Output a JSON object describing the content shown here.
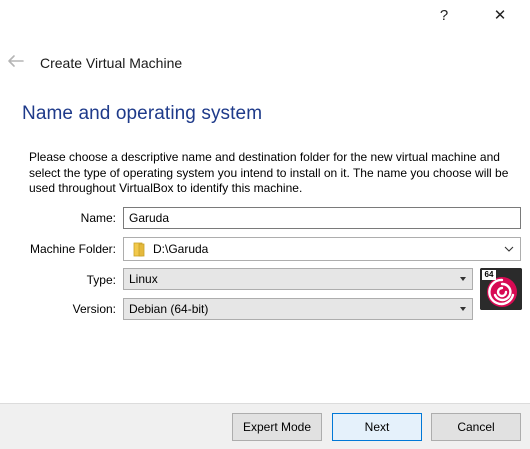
{
  "titlebar": {
    "help_label": "?",
    "close_label": "✕"
  },
  "wizard": {
    "title": "Create Virtual Machine",
    "section_title": "Name and operating system",
    "description": "Please choose a descriptive name and destination folder for the new virtual machine and select the type of operating system you intend to install on it. The name you choose will be used throughout VirtualBox to identify this machine."
  },
  "form": {
    "name_label": "Name:",
    "name_value": "Garuda",
    "folder_label": "Machine Folder:",
    "folder_value": "D:\\Garuda",
    "type_label": "Type:",
    "type_value": "Linux",
    "version_label": "Version:",
    "version_value": "Debian (64-bit)",
    "os_badge_text": "64"
  },
  "buttons": {
    "expert": "Expert Mode",
    "next": "Next",
    "cancel": "Cancel"
  },
  "colors": {
    "section_title": "#1e3a8a",
    "os_logo": "#d70a53"
  },
  "icons": {
    "back": "back-arrow-icon",
    "folder": "folder-icon",
    "os_logo": "debian-logo-icon"
  }
}
